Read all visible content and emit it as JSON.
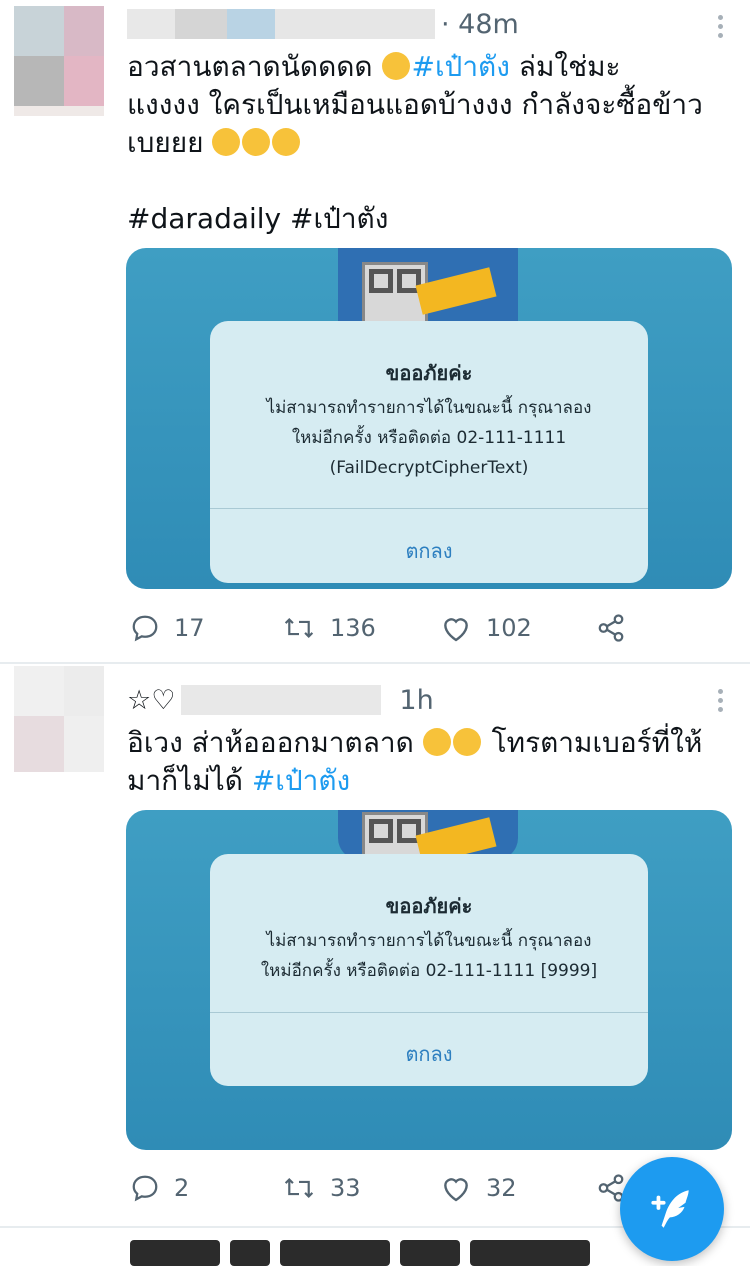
{
  "tweets": [
    {
      "time": "· 48m",
      "text_plain_1": "อวสานตลาดนัดดดด ",
      "hashtag_inline": "#เป๋าตัง",
      "text_plain_2": " ล่มใช่มะ",
      "line2": "แงงงง ใครเป็นเหมือนแอดบ้างงง กำลังจะซื้อข้าว",
      "line3": "เบยยย ",
      "hashtags": "#daradaily #เป๋าตัง",
      "dialog": {
        "title": "ขออภัยค่ะ",
        "msg1": "ไม่สามารถทำรายการได้ในขณะนี้ กรุณาลอง",
        "msg2": "ใหม่อีกครั้ง หรือติดต่อ 02-111-1111",
        "msg3": "(FailDecryptCipherText)",
        "ok": "ตกลง"
      },
      "replies": "17",
      "retweets": "136",
      "likes": "102"
    },
    {
      "prefix": "☆♡",
      "time": "1h",
      "line1": "อิเวง ส่าห้อออกมาตลาด ",
      "line1_b": " โทรตามเบอร์ที่ให้",
      "line2_plain": "มาก็ไม่ได้ ",
      "line2_tag": "#เป๋าตัง",
      "dialog": {
        "title": "ขออภัยค่ะ",
        "msg1": "ไม่สามารถทำรายการได้ในขณะนี้ กรุณาลอง",
        "msg2": "ใหม่อีกครั้ง หรือติดต่อ 02-111-1111 [9999]",
        "ok": "ตกลง"
      },
      "replies": "2",
      "retweets": "33",
      "likes": "32"
    }
  ],
  "colors": {
    "accent": "#1d9bf0",
    "muted": "#536471",
    "media_bg": "#3a98c0",
    "dialog_bg": "#d6ecf2"
  },
  "icons": [
    "reply-icon",
    "retweet-icon",
    "like-icon",
    "share-icon",
    "more-icon",
    "compose-icon"
  ]
}
